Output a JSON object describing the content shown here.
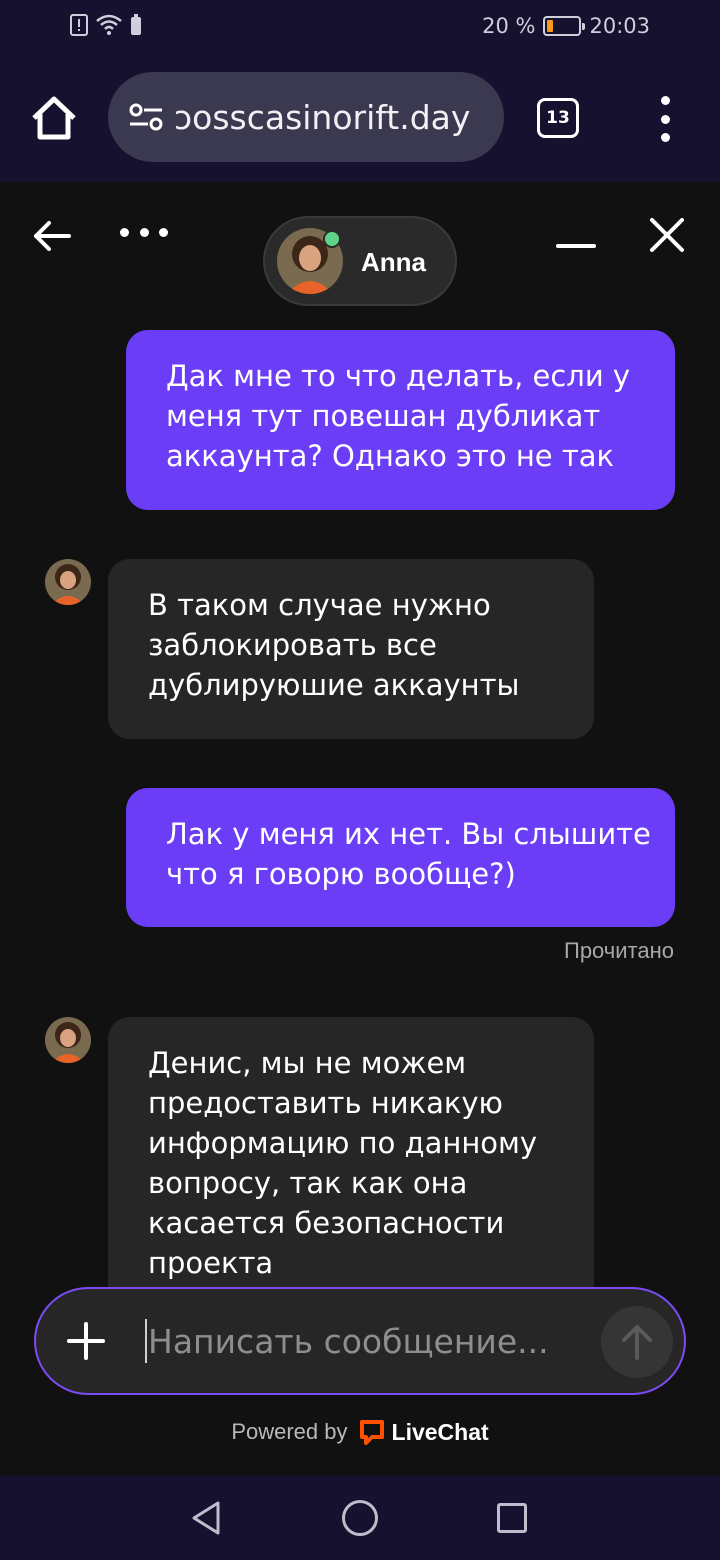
{
  "status_bar": {
    "battery_text": "20 %",
    "battery_level": 0.2,
    "time": "20:03"
  },
  "browser": {
    "url": "ɔosscasinorift.day",
    "tab_count": "13"
  },
  "chat": {
    "agent_name": "Anna",
    "agent_status": "online",
    "messages": [
      {
        "from": "user",
        "lines": [
          "Дак мне то что делать, если у",
          "меня тут повешан дубликат",
          "аккаунта? Однако это не так"
        ]
      },
      {
        "from": "agent",
        "lines": [
          "В таком случае нужно",
          "заблокировать все",
          "дублируюшие аккаунты"
        ]
      },
      {
        "from": "user",
        "lines": [
          "Лак у меня их нет. Вы слышите",
          "что я говорю вообще?)"
        ]
      },
      {
        "from": "agent",
        "lines": [
          "Денис, мы не можем",
          "предоставить никакую",
          "информацию по данному",
          "вопросу, так как она",
          "касается безопасности",
          "проекта"
        ]
      }
    ],
    "read_receipt": "Прочитано",
    "composer_placeholder": "Написать сообщение...",
    "powered_by": "Powered by",
    "brand": "LiveChat"
  },
  "colors": {
    "accent": "#6c3df6",
    "bar_bg": "#16112e",
    "chat_bg": "#111111",
    "agent_bubble": "#262626",
    "online": "#5fd38a",
    "brand_orange": "#ff5100"
  }
}
